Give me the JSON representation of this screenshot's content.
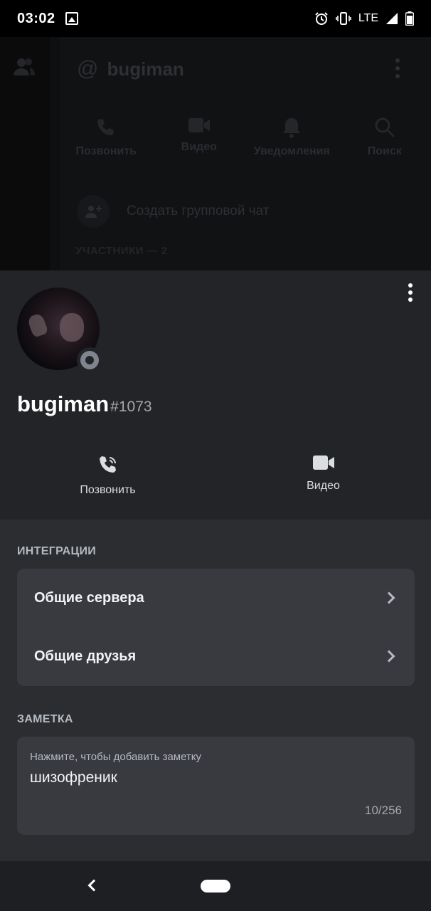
{
  "status_bar": {
    "time": "03:02",
    "network": "LTE"
  },
  "background_screen": {
    "title": "bugiman",
    "at_symbol": "@",
    "actions": [
      {
        "label": "Позвонить",
        "icon": "phone-call-icon"
      },
      {
        "label": "Видео",
        "icon": "video-camera-icon"
      },
      {
        "label": "Уведомления",
        "icon": "bell-icon"
      },
      {
        "label": "Поиск",
        "icon": "search-icon"
      }
    ],
    "group_chat_label": "Создать групповой чат",
    "members_label": "УЧАСТНИКИ — 2"
  },
  "profile": {
    "username": "bugiman",
    "discriminator": "#1073",
    "status": "offline",
    "actions": [
      {
        "label": "Позвонить",
        "icon": "phone-call-icon"
      },
      {
        "label": "Видео",
        "icon": "video-camera-icon"
      }
    ]
  },
  "integrations": {
    "header": "ИНТЕГРАЦИИ",
    "items": [
      {
        "label": "Общие сервера"
      },
      {
        "label": "Общие друзья"
      }
    ]
  },
  "note": {
    "header": "ЗАМЕТКА",
    "hint": "Нажмите, чтобы добавить заметку",
    "text": "шизофреник",
    "counter": "10/256"
  },
  "colors": {
    "sheet_background": "#2b2d31",
    "sheet_header": "#232428",
    "card": "#383a40",
    "offline_status": "#80848e"
  }
}
